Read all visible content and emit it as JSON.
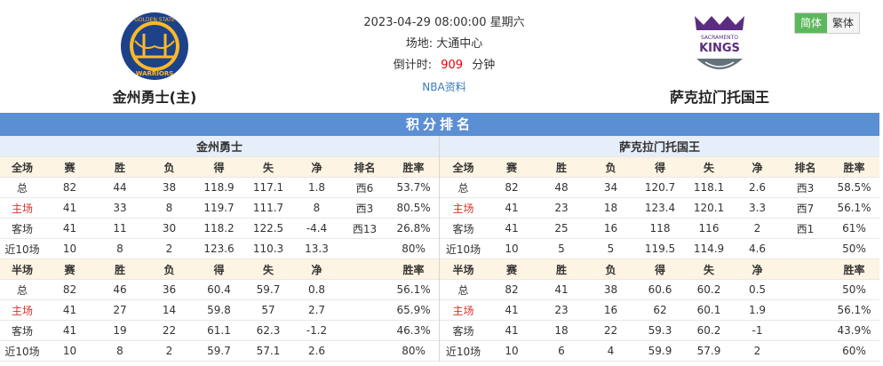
{
  "header": {
    "home_team": "金州勇士(主)",
    "away_team": "萨克拉门托国王",
    "datetime": "2023-04-29 08:00:00 星期六",
    "venue": "场地: 大通中心",
    "countdown_label": "倒计时:",
    "countdown_value": "909",
    "countdown_unit": "分钟",
    "info_link": "NBA资料",
    "home_logo_text": {
      "top": "GOLDEN STATE",
      "bottom": "WARRIORS"
    },
    "away_logo_text": {
      "top": "SACRAMENTO",
      "main": "KINGS"
    }
  },
  "lang": {
    "simplified": "简体",
    "traditional": "繁体"
  },
  "section_title": "积分排名",
  "columns": {
    "full_label": "全场",
    "half_label": "半场",
    "games": "赛",
    "wins": "胜",
    "losses": "负",
    "for": "得",
    "against": "失",
    "net": "净",
    "rank": "排名",
    "win_rate": "胜率"
  },
  "left": {
    "team": "金州勇士",
    "full": [
      [
        "总",
        "82",
        "44",
        "38",
        "118.9",
        "117.1",
        "1.8",
        "西6",
        "53.7%"
      ],
      [
        "主场",
        "41",
        "33",
        "8",
        "119.7",
        "111.7",
        "8",
        "西3",
        "80.5%"
      ],
      [
        "客场",
        "41",
        "11",
        "30",
        "118.2",
        "122.5",
        "-4.4",
        "西13",
        "26.8%"
      ],
      [
        "近10场",
        "10",
        "8",
        "2",
        "123.6",
        "110.3",
        "13.3",
        "",
        "80%"
      ]
    ],
    "half": [
      [
        "总",
        "82",
        "46",
        "36",
        "60.4",
        "59.7",
        "0.8",
        "",
        "56.1%"
      ],
      [
        "主场",
        "41",
        "27",
        "14",
        "59.8",
        "57",
        "2.7",
        "",
        "65.9%"
      ],
      [
        "客场",
        "41",
        "19",
        "22",
        "61.1",
        "62.3",
        "-1.2",
        "",
        "46.3%"
      ],
      [
        "近10场",
        "10",
        "8",
        "2",
        "59.7",
        "57.1",
        "2.6",
        "",
        "80%"
      ]
    ]
  },
  "right": {
    "team": "萨克拉门托国王",
    "full": [
      [
        "总",
        "82",
        "48",
        "34",
        "120.7",
        "118.1",
        "2.6",
        "西3",
        "58.5%"
      ],
      [
        "主场",
        "41",
        "23",
        "18",
        "123.4",
        "120.1",
        "3.3",
        "西7",
        "56.1%"
      ],
      [
        "客场",
        "41",
        "25",
        "16",
        "118",
        "116",
        "2",
        "西1",
        "61%"
      ],
      [
        "近10场",
        "10",
        "5",
        "5",
        "119.5",
        "114.9",
        "4.6",
        "",
        "50%"
      ]
    ],
    "half": [
      [
        "总",
        "82",
        "41",
        "38",
        "60.6",
        "60.2",
        "0.5",
        "",
        "50%"
      ],
      [
        "主场",
        "41",
        "23",
        "16",
        "62",
        "60.1",
        "1.9",
        "",
        "56.1%"
      ],
      [
        "客场",
        "41",
        "18",
        "22",
        "59.3",
        "60.2",
        "-1",
        "",
        "43.9%"
      ],
      [
        "近10场",
        "10",
        "6",
        "4",
        "59.9",
        "57.9",
        "2",
        "",
        "60%"
      ]
    ]
  },
  "colors": {
    "accent": "#5b8fd4",
    "red": "#d9312b",
    "green": "#5cb85c"
  }
}
